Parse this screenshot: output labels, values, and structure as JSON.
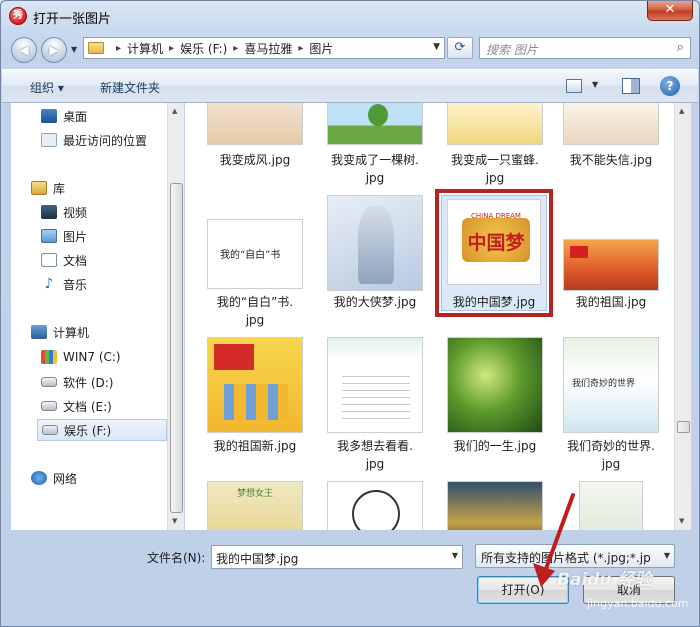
{
  "window": {
    "title": "打开一张图片",
    "close_glyph": "✕",
    "app_glyph": "秀"
  },
  "nav": {
    "back_glyph": "◀",
    "forward_glyph": "▶"
  },
  "address": {
    "crumbs": [
      "计算机",
      "娱乐 (F:)",
      "喜马拉雅",
      "图片"
    ],
    "separator": "▸"
  },
  "search": {
    "placeholder": "搜索 图片"
  },
  "toolbar": {
    "organize_label": "组织 ▾",
    "new_folder_label": "新建文件夹",
    "help_glyph": "?"
  },
  "sidebar": {
    "items": [
      {
        "label": "桌面",
        "icon": "desktop-icon"
      },
      {
        "label": "最近访问的位置",
        "icon": "recent-icon"
      },
      {
        "label": "库",
        "icon": "library-icon"
      },
      {
        "label": "视频",
        "icon": "video-icon"
      },
      {
        "label": "图片",
        "icon": "pictures-icon"
      },
      {
        "label": "文档",
        "icon": "documents-icon"
      },
      {
        "label": "音乐",
        "icon": "music-icon"
      },
      {
        "label": "计算机",
        "icon": "computer-icon"
      },
      {
        "label": "WIN7 (C:)",
        "icon": "windows-drive-icon"
      },
      {
        "label": "软件 (D:)",
        "icon": "drive-icon"
      },
      {
        "label": "文档 (E:)",
        "icon": "drive-icon"
      },
      {
        "label": "娱乐 (F:)",
        "icon": "drive-icon"
      },
      {
        "label": "网络",
        "icon": "network-icon"
      }
    ]
  },
  "files": [
    {
      "line1": "我变成风.jpg",
      "line2": ""
    },
    {
      "line1": "我变成了一棵树.",
      "line2": "jpg"
    },
    {
      "line1": "我变成一只蜜蜂.",
      "line2": "jpg"
    },
    {
      "line1": "我不能失信.jpg",
      "line2": ""
    },
    {
      "line1": "我的“自白”书.",
      "line2": "jpg",
      "thumb_text": "我的“自白”书"
    },
    {
      "line1": "我的大侠梦.jpg",
      "line2": ""
    },
    {
      "line1": "我的中国梦.jpg",
      "line2": "",
      "thumb_text": "中国梦",
      "thumb_sub": "CHINA DREAM"
    },
    {
      "line1": "我的祖国.jpg",
      "line2": ""
    },
    {
      "line1": "我的祖国新.jpg",
      "line2": ""
    },
    {
      "line1": "我多想去看看.",
      "line2": "jpg"
    },
    {
      "line1": "我们的一生.jpg",
      "line2": ""
    },
    {
      "line1": "我们奇妙的世界.",
      "line2": "jpg",
      "thumb_text": "我们奇妙的世界"
    },
    {
      "line1": "",
      "line2": "",
      "thumb_text": "梦想女王"
    },
    {
      "line1": "",
      "line2": ""
    },
    {
      "line1": "",
      "line2": ""
    },
    {
      "line1": "",
      "line2": ""
    }
  ],
  "footer": {
    "filename_label": "文件名(N):",
    "filename_value": "我的中国梦.jpg",
    "filter_value": "所有支持的图片格式 (*.jpg;*.jp",
    "open_label": "打开(O)",
    "cancel_label": "取消"
  },
  "watermark": {
    "text": "Baidu 经验",
    "sub": "jingyan.baidu.com"
  },
  "colors": {
    "highlight_frame": "#b32424",
    "arrow": "#c01e1e"
  }
}
